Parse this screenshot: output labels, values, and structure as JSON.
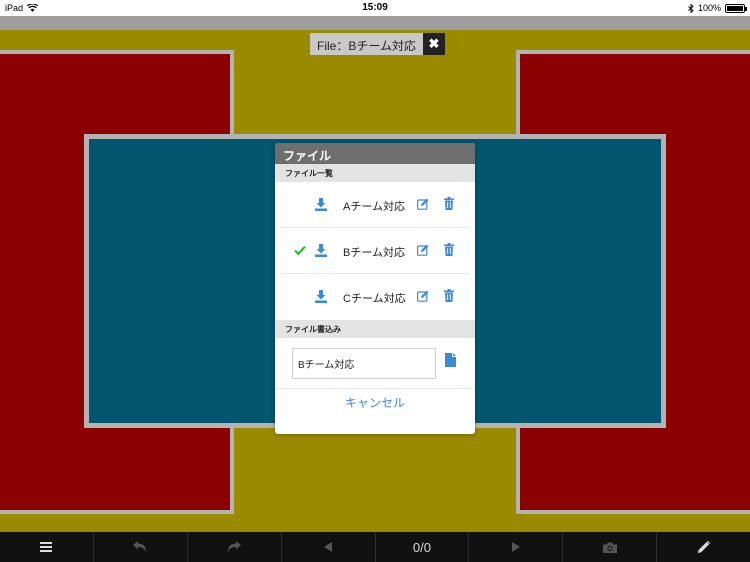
{
  "status_bar": {
    "device": "iPad",
    "time": "15:09",
    "battery": "100%"
  },
  "file_label": {
    "text": "File：Bチーム対応",
    "close_icon": "✖"
  },
  "dialog": {
    "title": "ファイル",
    "list_section_title": "ファイル一覧",
    "files": [
      {
        "name": "Aチーム対応",
        "selected": false
      },
      {
        "name": "Bチーム対応",
        "selected": true
      },
      {
        "name": "Cチーム対応",
        "selected": false
      }
    ],
    "write_section_title": "ファイル書込み",
    "write_value": "Bチーム対応",
    "cancel_label": "キャンセル"
  },
  "toolbar": {
    "page_counter": "0/0",
    "icons": [
      "menu-icon",
      "undo-icon",
      "redo-icon",
      "prev-icon",
      "page-counter",
      "next-icon",
      "camera-icon",
      "pencil-icon"
    ]
  },
  "colors": {
    "court_yellow": "#9a8a00",
    "court_red": "#8b0000",
    "court_blue": "#02566f",
    "accent_blue": "#3a8ad6",
    "check_green": "#2eb82e"
  }
}
